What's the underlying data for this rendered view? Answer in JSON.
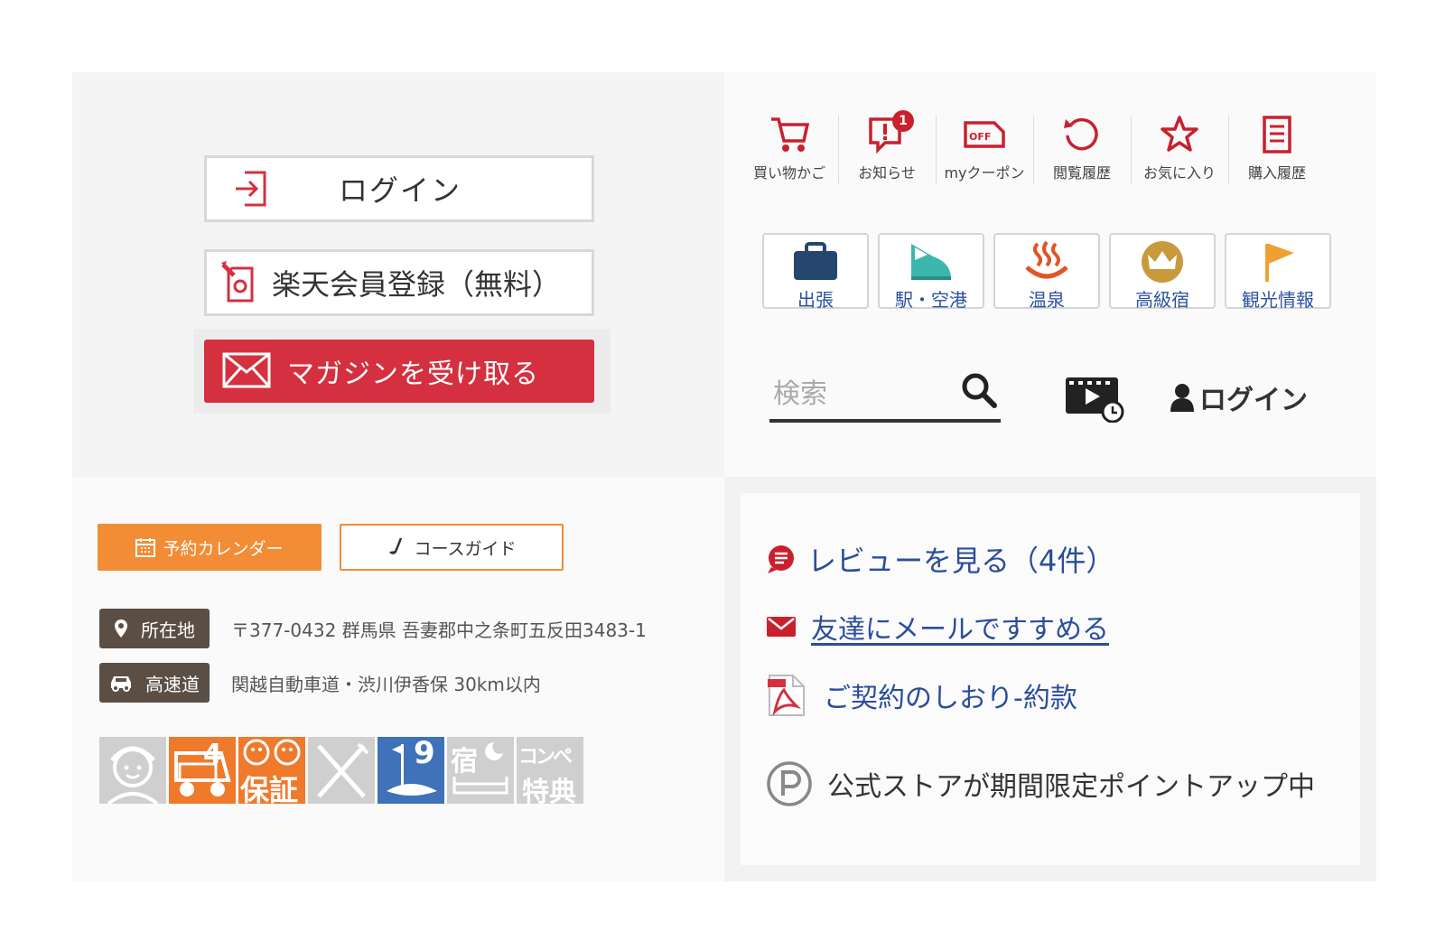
{
  "member": {
    "login_label": "ログイン",
    "register_label": "楽天会員登録（無料）",
    "magazine_label": "マガジンを受け取る"
  },
  "header_nav": [
    {
      "label": "買い物かご",
      "icon": "cart-icon"
    },
    {
      "label": "お知らせ",
      "icon": "notice-icon",
      "badge": "1"
    },
    {
      "label": "myクーポン",
      "icon": "coupon-icon"
    },
    {
      "label": "閲覧履歴",
      "icon": "history-icon"
    },
    {
      "label": "お気に入り",
      "icon": "star-icon"
    },
    {
      "label": "購入履歴",
      "icon": "receipt-icon"
    }
  ],
  "coupon_icon_text": "OFF",
  "categories": [
    {
      "label": "出張",
      "icon": "briefcase-icon"
    },
    {
      "label": "駅・空港",
      "icon": "train-icon"
    },
    {
      "label": "温泉",
      "icon": "hot-spring-icon"
    },
    {
      "label": "高級宿",
      "icon": "crown-icon"
    },
    {
      "label": "観光情報",
      "icon": "flag-icon"
    }
  ],
  "search": {
    "placeholder": "検索"
  },
  "header_login_label": "ログイン",
  "golf": {
    "calendar_label": "予約カレンダー",
    "course_guide_label": "コースガイド",
    "address_tag": "所在地",
    "address_value": "〒377-0432 群馬県 吾妻郡中之条町五反田3483-1",
    "highway_tag": "高速道",
    "highway_value": "関越自動車道・渋川伊香保 30km以内",
    "facility_texts": {
      "cart_number": "4",
      "guarantee": "保証",
      "hole_number": "9",
      "lodging": "宿",
      "compe_1": "コンペ",
      "compe_2": "特典"
    }
  },
  "links": {
    "review": "レビューを見る（4件）",
    "mail": "友達にメールですすめる",
    "terms": "ご契約のしおり-約款",
    "point": "公式ストアが期間限定ポイントアップ中"
  },
  "colors": {
    "brand_red": "#d5303f",
    "nav_red": "#c9202e",
    "link_blue": "#2b4d9b",
    "golf_orange": "#f28c35",
    "tag_brown": "#5a4e45"
  }
}
